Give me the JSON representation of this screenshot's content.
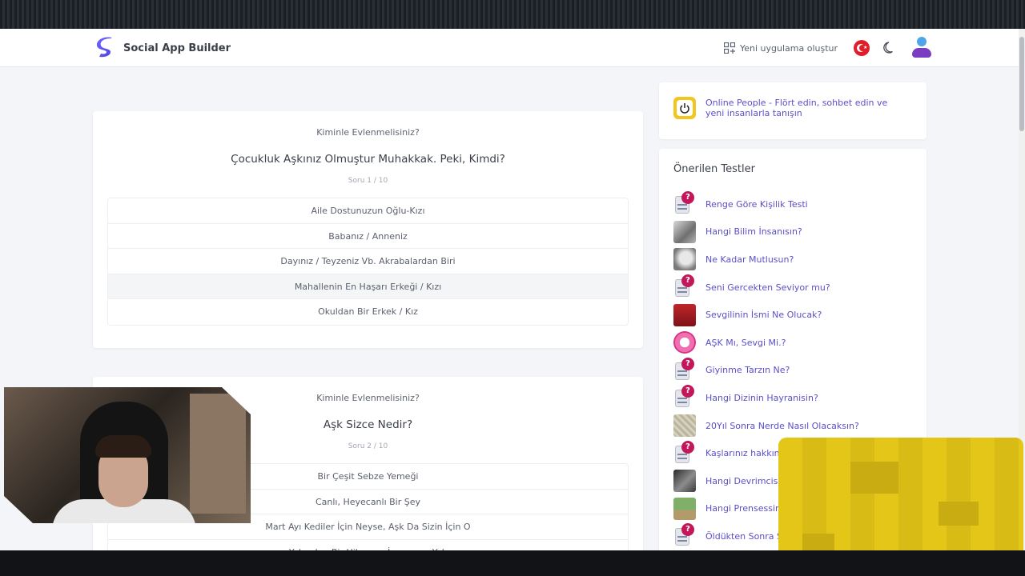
{
  "app": {
    "brand_name": "Social App Builder"
  },
  "header": {
    "create_label": "Yeni uygulama oluştur"
  },
  "quizzes": [
    {
      "quiz_name": "Kiminle Evlenmelisiniz?",
      "question": "Çocukluk Aşkınız Olmuştur Muhakkak. Peki, Kimdi?",
      "counter": "Soru 1 / 10",
      "answers": [
        "Aile Dostunuzun Oğlu-Kızı",
        "Babanız / Anneniz",
        "Dayınız / Teyzeniz Vb. Akrabalardan Biri",
        "Mahallenin En Haşarı Erkeği / Kızı",
        "Okuldan Bir Erkek / Kız"
      ]
    },
    {
      "quiz_name": "Kiminle Evlenmelisiniz?",
      "question": "Aşk Sizce Nedir?",
      "counter": "Soru 2 / 10",
      "answers": [
        "Bir Çeşit Sebze Yemeği",
        "Canlı, Heyecanlı Bir Şey",
        "Mart Ayı Kediler İçin Neyse, Aşk Da Sizin İçin O",
        "Yalandan Bir Hikaye... İnsanımız Yok"
      ]
    }
  ],
  "sidebar": {
    "promo_text": "Online People - Flört edin, sohbet edin ve yeni insanlarla tanışın",
    "recommended_title": "Önerilen Testler",
    "recommended": [
      {
        "label": "Renge Göre Kişilik Testi",
        "icon": "quiz-icon"
      },
      {
        "label": "Hangi Bilim İnsanısın?",
        "icon": "photo-thumbnail"
      },
      {
        "label": "Ne Kadar Mutlusun?",
        "icon": "photo-thumbnail"
      },
      {
        "label": "Seni Gercekten Seviyor mu?",
        "icon": "quiz-icon"
      },
      {
        "label": "Sevgilinin İsmi Ne Olucak?",
        "icon": "photo-thumbnail"
      },
      {
        "label": "AŞK Mı, Sevgi Mi.?",
        "icon": "photo-thumbnail"
      },
      {
        "label": "Giyinme Tarzın Ne?",
        "icon": "quiz-icon"
      },
      {
        "label": "Hangi Dizinin Hayranisin?",
        "icon": "quiz-icon"
      },
      {
        "label": "20Yıl Sonra Nerde Nasıl Olacaksın?",
        "icon": "photo-thumbnail"
      },
      {
        "label": "Kaşlarınız hakkın",
        "icon": "quiz-icon"
      },
      {
        "label": "Hangi Devrimcisin",
        "icon": "photo-thumbnail"
      },
      {
        "label": "Hangi Prensessin",
        "icon": "photo-thumbnail"
      },
      {
        "label": "Öldükten Sonra S",
        "icon": "quiz-icon"
      }
    ]
  }
}
